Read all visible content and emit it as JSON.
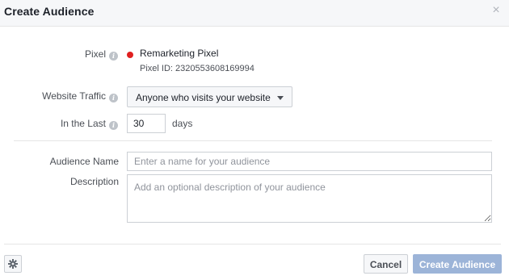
{
  "dialog": {
    "title": "Create Audience",
    "close_symbol": "×"
  },
  "form": {
    "pixel": {
      "label": "Pixel",
      "info_icon": "info-icon",
      "status_color": "#e02020",
      "name": "Remarketing Pixel",
      "id_text": "Pixel ID: 2320553608169994"
    },
    "website_traffic": {
      "label": "Website Traffic",
      "selected": "Anyone who visits your website"
    },
    "in_the_last": {
      "label": "In the Last",
      "value": "30",
      "unit": "days"
    },
    "audience_name": {
      "label": "Audience Name",
      "placeholder": "Enter a name for your audience",
      "value": ""
    },
    "description": {
      "label": "Description",
      "placeholder": "Add an optional description of your audience",
      "value": ""
    }
  },
  "footer": {
    "settings_icon": "gear-icon",
    "cancel_label": "Cancel",
    "create_label": "Create Audience",
    "create_color": "#9cb4d8"
  }
}
